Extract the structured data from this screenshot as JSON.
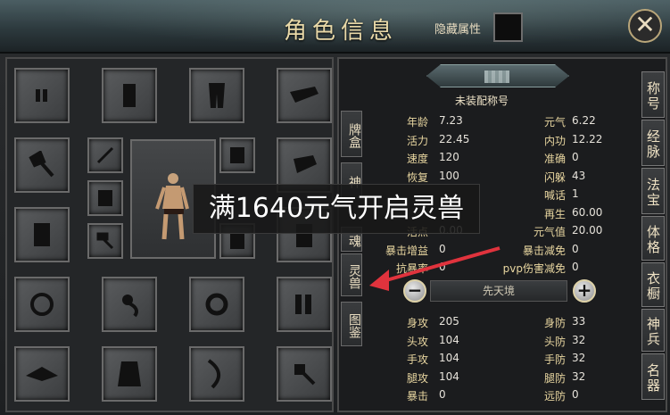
{
  "window": {
    "title": "角色信息",
    "hide_attributes_label": "隐藏属性",
    "close_icon": "close-x-icon"
  },
  "equipment_slots": [
    {
      "name": "bracer-slot",
      "icon": "bracer-icon"
    },
    {
      "name": "chest-slot",
      "icon": "chest-armor-icon"
    },
    {
      "name": "pants-slot",
      "icon": "pants-icon"
    },
    {
      "name": "hat-slot",
      "icon": "hat-icon"
    },
    {
      "name": "axe-slot",
      "icon": "axe-icon"
    },
    {
      "name": "staff-slot",
      "icon": "staff-icon"
    },
    {
      "name": "armor-slot-left",
      "icon": "armor-icon"
    },
    {
      "name": "armor-slot-right",
      "icon": "armor-icon"
    },
    {
      "name": "cloak-slot",
      "icon": "cloak-icon"
    },
    {
      "name": "vest-slot",
      "icon": "vest-icon"
    },
    {
      "name": "hammer-slot",
      "icon": "hammer-icon"
    },
    {
      "name": "necklace-slot",
      "icon": "necklace-icon"
    },
    {
      "name": "pendant-slot",
      "icon": "pendant-icon"
    },
    {
      "name": "ring-slot",
      "icon": "ring-icon"
    },
    {
      "name": "boots-slot",
      "icon": "boots-icon"
    },
    {
      "name": "wing-slot",
      "icon": "wing-icon"
    },
    {
      "name": "robe-slot",
      "icon": "robe-icon"
    },
    {
      "name": "blade-slot",
      "icon": "blade-icon"
    },
    {
      "name": "mace-slot",
      "icon": "mace-icon"
    }
  ],
  "title_badge": {
    "no_title_text": "未装配称号"
  },
  "left_tabs": [
    {
      "label": "牌盒"
    },
    {
      "label": "神"
    },
    {
      "label": "魂"
    },
    {
      "label": "灵兽"
    },
    {
      "label": "图鉴"
    }
  ],
  "right_tabs": [
    {
      "label": "称号"
    },
    {
      "label": "经脉"
    },
    {
      "label": "法宝"
    },
    {
      "label": "体格"
    },
    {
      "label": "衣橱"
    },
    {
      "label": "神兵"
    },
    {
      "label": "名器"
    }
  ],
  "stats_top": [
    {
      "label": "年龄",
      "value": "7.23",
      "label2": "元气",
      "value2": "6.22"
    },
    {
      "label": "活力",
      "value": "22.45",
      "label2": "内功",
      "value2": "12.22"
    },
    {
      "label": "速度",
      "value": "120",
      "label2": "准确",
      "value2": "0"
    },
    {
      "label": "恢复",
      "value": "100",
      "label2": "闪躲",
      "value2": "43"
    },
    {
      "label": "",
      "value": "",
      "label2": "喊话",
      "value2": "1"
    },
    {
      "label": "",
      "value": "",
      "label2": "再生",
      "value2": "60.00"
    },
    {
      "label": "活点",
      "value": "0.00",
      "label2": "元气值",
      "value2": "20.00"
    },
    {
      "label": "暴击增益",
      "value": "0",
      "label2": "暴击减免",
      "value2": "0"
    },
    {
      "label": "抗暴率",
      "value": "0",
      "label2": "pvp伤害减免",
      "value2": "0"
    }
  ],
  "realm": {
    "label": "先天境",
    "minus": "−",
    "plus": "+"
  },
  "stats_bottom": [
    {
      "label": "身攻",
      "value": "205",
      "label2": "身防",
      "value2": "33"
    },
    {
      "label": "头攻",
      "value": "104",
      "label2": "头防",
      "value2": "32"
    },
    {
      "label": "手攻",
      "value": "104",
      "label2": "手防",
      "value2": "32"
    },
    {
      "label": "腿攻",
      "value": "104",
      "label2": "腿防",
      "value2": "32"
    },
    {
      "label": "暴击",
      "value": "0",
      "label2": "远防",
      "value2": "0"
    }
  ],
  "banner": {
    "text": "满1640元气开启灵兽"
  }
}
